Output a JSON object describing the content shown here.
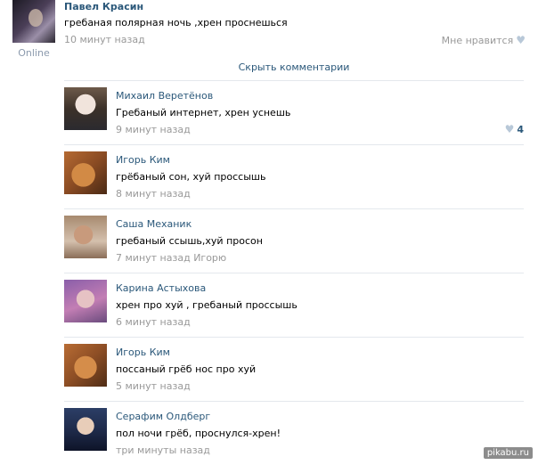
{
  "post": {
    "author": "Павел Красин",
    "status": "Online",
    "text": "гребаная полярная ночь ,хрен проснешься",
    "time": "10 минут назад",
    "like_label": "Мне нравится"
  },
  "hide_comments_label": "Скрыть комментарии",
  "comments": [
    {
      "author": "Михаил Веретёнов",
      "text": "Гребаный интернет, хрен уснешь",
      "time": "9 минут назад",
      "reply": "",
      "likes": "4"
    },
    {
      "author": "Игорь Ким",
      "text": "грёбаный сон, хуй проссышь",
      "time": "8 минут назад",
      "reply": "",
      "likes": ""
    },
    {
      "author": "Саша Механик",
      "text": "гребаный ссышь,хуй просон",
      "time": "7 минут назад",
      "reply": "Игорю",
      "likes": ""
    },
    {
      "author": "Карина Астыхова",
      "text": "хрен про хуй , гребаный проссышь",
      "time": "6 минут назад",
      "reply": "",
      "likes": ""
    },
    {
      "author": "Игорь Ким",
      "text": "поссаный грёб нос про хуй",
      "time": "5 минут назад",
      "reply": "",
      "likes": ""
    },
    {
      "author": "Серафим Олдберг",
      "text": "пол ночи грёб, проснулся-хрен!",
      "time": "три минуты назад",
      "reply": "",
      "likes": ""
    }
  ],
  "watermark": "pikabu.ru",
  "colors": {
    "link": "#2b587a",
    "muted": "#999999",
    "divider": "#e4e8ed"
  }
}
